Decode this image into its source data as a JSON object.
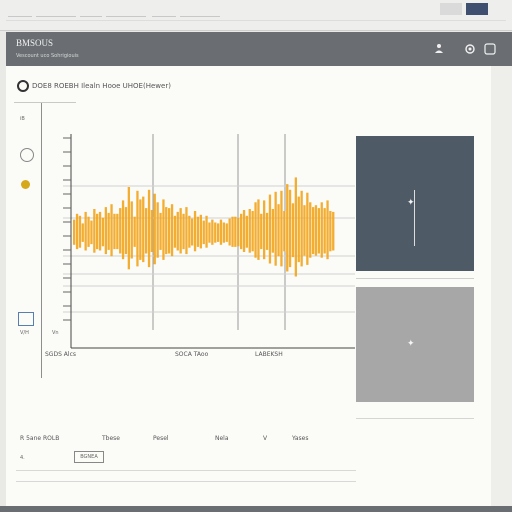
{
  "browser": {
    "tabs": [
      "",
      "",
      "",
      "",
      "",
      ""
    ],
    "badge": "",
    "title_text": ""
  },
  "app": {
    "title": "BMSOUS",
    "subtitle": "Vescount uco Sohrigiouis",
    "icons": {
      "user": "user-icon",
      "settings": "gear-icon",
      "help": "help-icon"
    }
  },
  "panel": {
    "title": "DOE8 ROEBH Ilealn Hooe UHOE(Hewer)",
    "status_icon": "circle-status-icon"
  },
  "sidebar": {
    "items": [
      "iB",
      "",
      "",
      "",
      "",
      "",
      "",
      "",
      "",
      "",
      "",
      "",
      "",
      "",
      "",
      "",
      "",
      "",
      "",
      "",
      ""
    ],
    "bottom_labels": [
      "V/H",
      "Vn"
    ]
  },
  "chart_data": {
    "type": "bar",
    "title": "",
    "xlabel": "",
    "ylabel": "",
    "x_tick_labels": [
      "SGDS Alcs",
      "SOCA TAoo",
      "LABEKSH"
    ],
    "y_tick_labels": [
      "",
      "",
      "",
      "",
      "",
      "",
      "",
      "",
      "",
      "",
      "",
      "",
      "",
      ""
    ],
    "ylim": [
      -1,
      1
    ],
    "grid": true,
    "series": [
      {
        "color": "#f2a51c",
        "values": [
          0.15,
          0.21,
          0.19,
          0.11,
          0.23,
          0.18,
          0.14,
          0.26,
          0.21,
          0.23,
          0.17,
          0.28,
          0.22,
          0.31,
          0.21,
          0.21,
          0.27,
          0.35,
          0.28,
          0.49,
          0.34,
          0.18,
          0.45,
          0.36,
          0.39,
          0.27,
          0.46,
          0.25,
          0.42,
          0.33,
          0.22,
          0.36,
          0.28,
          0.27,
          0.31,
          0.19,
          0.23,
          0.27,
          0.21,
          0.28,
          0.19,
          0.16,
          0.24,
          0.18,
          0.2,
          0.14,
          0.19,
          0.12,
          0.15,
          0.12,
          0.11,
          0.15,
          0.12,
          0.11,
          0.16,
          0.18,
          0.18,
          0.17,
          0.21,
          0.25,
          0.19,
          0.26,
          0.24,
          0.33,
          0.36,
          0.21,
          0.35,
          0.22,
          0.41,
          0.26,
          0.44,
          0.31,
          0.45,
          0.24,
          0.52,
          0.46,
          0.32,
          0.59,
          0.39,
          0.45,
          0.3,
          0.43,
          0.33,
          0.28,
          0.3,
          0.27,
          0.33,
          0.27,
          0.35,
          0.24,
          0.23
        ]
      }
    ]
  },
  "images": {
    "top_marker": "✦",
    "bottom_marker": "✦"
  },
  "table": {
    "headers": [
      "R 5ane ROLB",
      "Tbese",
      "Pesel",
      "Nela",
      "V",
      "Yases"
    ],
    "rows": [
      [
        "4.",
        "",
        "BGNEA",
        "",
        "",
        ""
      ],
      [
        "",
        "",
        "",
        "",
        "",
        ""
      ],
      [
        "",
        "",
        "",
        "",
        "",
        ""
      ]
    ]
  }
}
